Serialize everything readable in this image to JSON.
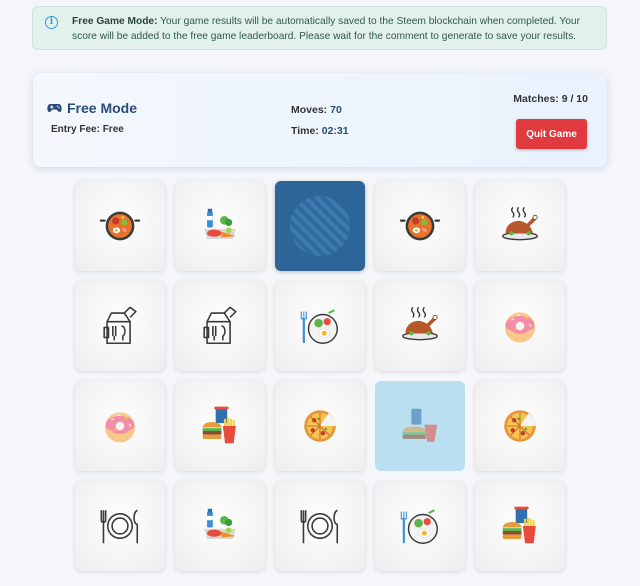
{
  "notice": {
    "title": "Free Game Mode:",
    "message": "Your game results will be automatically saved to the Steem blockchain when completed. Your score will be added to the free game leaderboard. Please wait for the comment to generate to save your results."
  },
  "status": {
    "mode": "Free Mode",
    "entry_fee_label": "Entry Fee:",
    "entry_fee_value": "Free",
    "moves_label": "Moves:",
    "moves_value": "70",
    "time_label": "Time:",
    "time_value": "02:31",
    "matches_label": "Matches:",
    "matches_value": "9 / 10",
    "quit_label": "Quit Game"
  },
  "board": {
    "rows": 4,
    "cols": 5,
    "cards": [
      {
        "icon": "paella-pan-icon",
        "state": "face-up"
      },
      {
        "icon": "groceries-icon",
        "state": "face-up"
      },
      {
        "icon": "card-back",
        "state": "face-down"
      },
      {
        "icon": "paella-pan-icon",
        "state": "face-up"
      },
      {
        "icon": "roast-chicken-icon",
        "state": "face-up"
      },
      {
        "icon": "takeaway-bag-icon",
        "state": "face-up"
      },
      {
        "icon": "takeaway-bag-icon",
        "state": "face-up"
      },
      {
        "icon": "breakfast-plate-icon",
        "state": "face-up"
      },
      {
        "icon": "roast-chicken-icon",
        "state": "face-up"
      },
      {
        "icon": "donut-icon",
        "state": "face-up"
      },
      {
        "icon": "donut-icon",
        "state": "face-up"
      },
      {
        "icon": "fast-food-icon",
        "state": "face-up"
      },
      {
        "icon": "pizza-icon",
        "state": "face-up"
      },
      {
        "icon": "soda-burger-icon",
        "state": "selected"
      },
      {
        "icon": "pizza-icon",
        "state": "face-up"
      },
      {
        "icon": "plate-cutlery-icon",
        "state": "face-up"
      },
      {
        "icon": "groceries-icon",
        "state": "face-up"
      },
      {
        "icon": "plate-cutlery-icon",
        "state": "face-up"
      },
      {
        "icon": "breakfast-plate-icon",
        "state": "face-up"
      },
      {
        "icon": "fast-food-icon",
        "state": "face-up"
      }
    ]
  }
}
